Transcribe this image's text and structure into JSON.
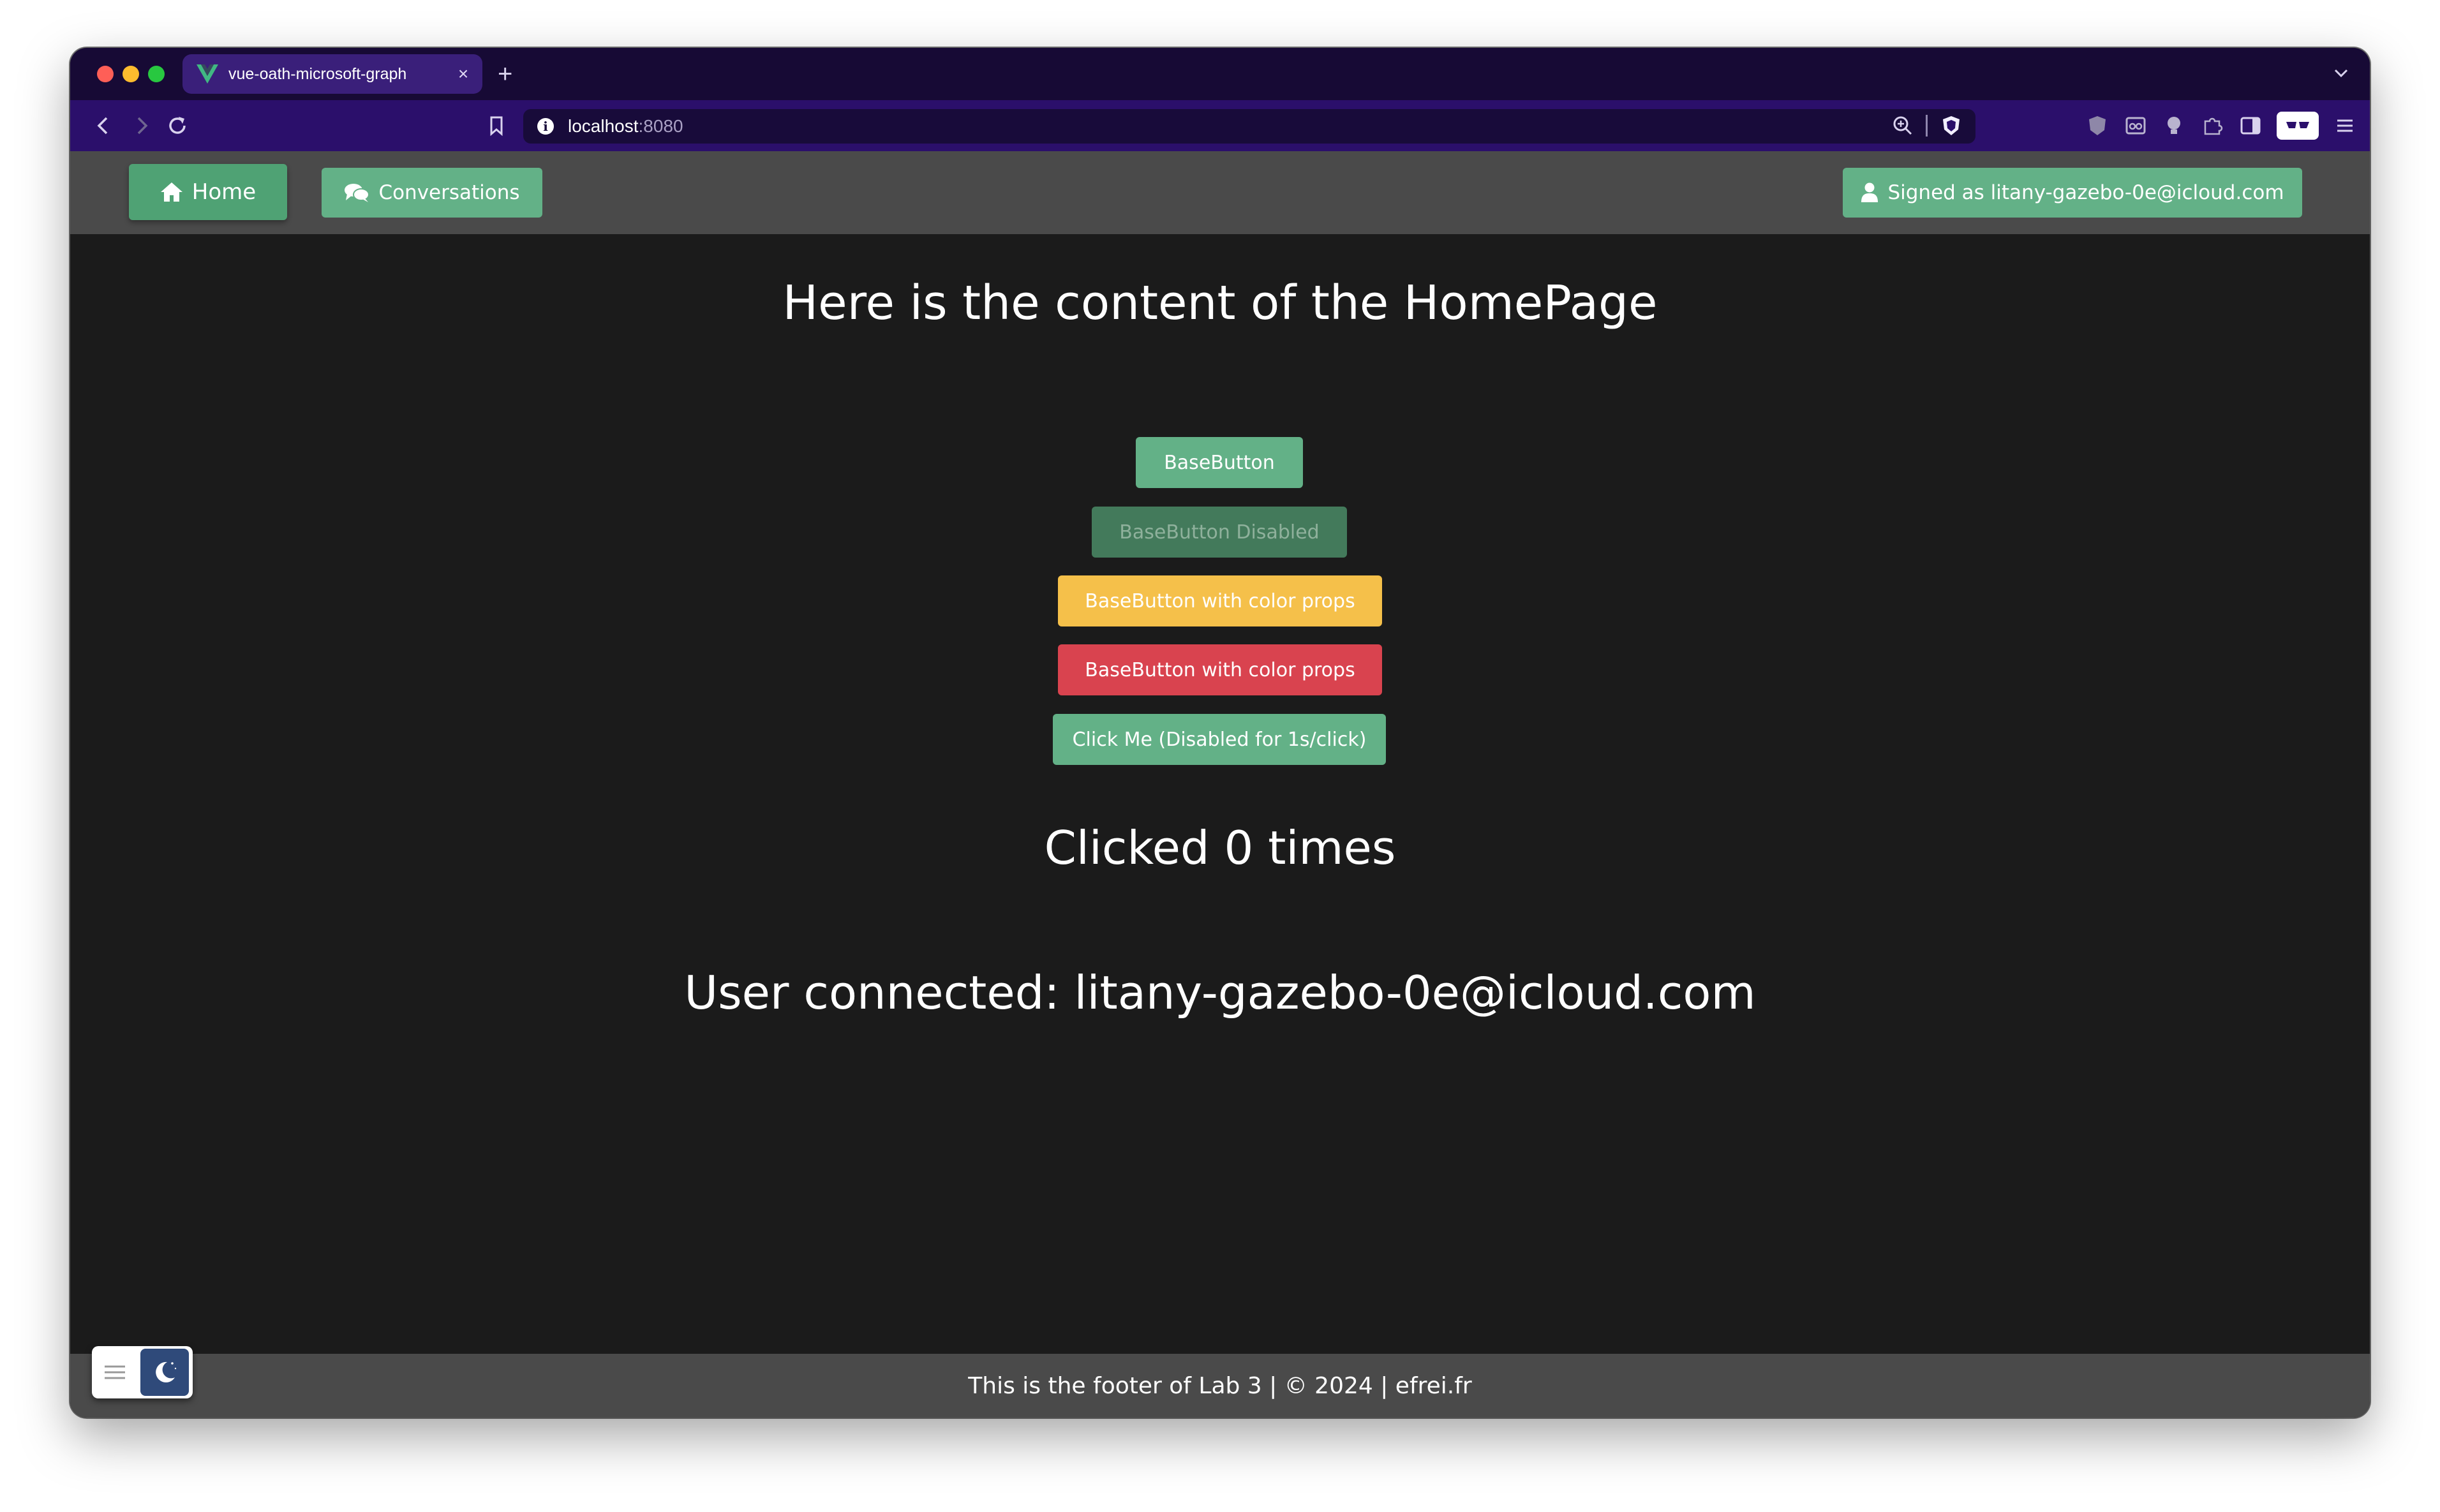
{
  "browser": {
    "tab_title": "vue-oath-microsoft-graph",
    "tab_close": "×",
    "new_tab": "+",
    "url_host": "localhost",
    "url_port": ":8080",
    "info_glyph": "i"
  },
  "nav": {
    "home_label": "Home",
    "conversations_label": "Conversations",
    "signed_label": "Signed as litany-gazebo-0e@icloud.com"
  },
  "main": {
    "title": "Here is the content of the HomePage",
    "buttons": [
      "BaseButton",
      "BaseButton Disabled",
      "BaseButton with color props",
      "BaseButton with color props",
      "Click Me (Disabled for 1s/click)"
    ],
    "clicked_text": "Clicked 0 times",
    "user_text": "User connected: litany-gazebo-0e@icloud.com"
  },
  "footer": {
    "text": "This is the footer of Lab 3 | © 2024 | efrei.fr"
  },
  "colors": {
    "tabbar": "#170a35",
    "addressbar": "#2b0f6b",
    "nav_bg": "#4a4a4a",
    "page_bg": "#1b1b1b",
    "green": "#63b187",
    "green_disabled": "#437a5b",
    "yellow": "#f5c04a",
    "red": "#d9434f"
  },
  "icons": {
    "favicon": "vue-logo-icon",
    "home": "home-icon",
    "conversations": "comments-icon",
    "user": "user-icon",
    "theme": "moon-icon"
  }
}
